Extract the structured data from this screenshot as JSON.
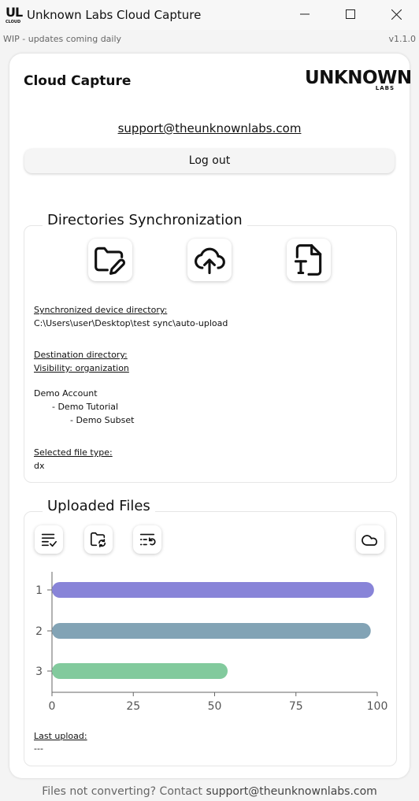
{
  "window": {
    "app_logo_big": "UL",
    "app_logo_small": "CLOUD",
    "title": "Unknown Labs Cloud Capture"
  },
  "banner": {
    "wip": "WIP - updates coming daily",
    "version": "v1.1.0"
  },
  "header": {
    "app_title": "Cloud Capture",
    "brand_main": "UNKNOWN",
    "brand_sub": "LABS",
    "email": "support@theunknownlabs.com",
    "logout_label": "Log out"
  },
  "sync": {
    "title": "Directories Synchronization",
    "icons": [
      "folder-edit-icon",
      "cloud-upload-icon",
      "file-type-icon"
    ],
    "device_dir_label": "Synchronized device directory:",
    "device_dir_value": "C:\\Users\\user\\Desktop\\test sync\\auto-upload",
    "dest_label": "Destination directory:",
    "visibility_label": "Visibility: organization",
    "tree": [
      "Demo Account",
      "- Demo Tutorial",
      "- Demo Subset"
    ],
    "file_type_label": "Selected file type:",
    "file_type_value": "dx"
  },
  "uploads": {
    "title": "Uploaded Files",
    "icons": [
      "list-check-icon",
      "folder-sync-icon",
      "list-restart-icon",
      "cloud-icon"
    ],
    "last_upload_label": "Last upload:",
    "last_upload_value": "---"
  },
  "chart_data": {
    "type": "bar",
    "orientation": "horizontal",
    "categories": [
      "1",
      "2",
      "3"
    ],
    "values": [
      99,
      98,
      54
    ],
    "colors": [
      "#8884d8",
      "#82a3b5",
      "#82ca9d"
    ],
    "xlim": [
      0,
      100
    ],
    "x_ticks": [
      "0",
      "25",
      "50",
      "75",
      "100"
    ],
    "grid": false
  },
  "footer": {
    "text": "Files not converting? Contact ",
    "email": "support@theunknownlabs.com"
  }
}
